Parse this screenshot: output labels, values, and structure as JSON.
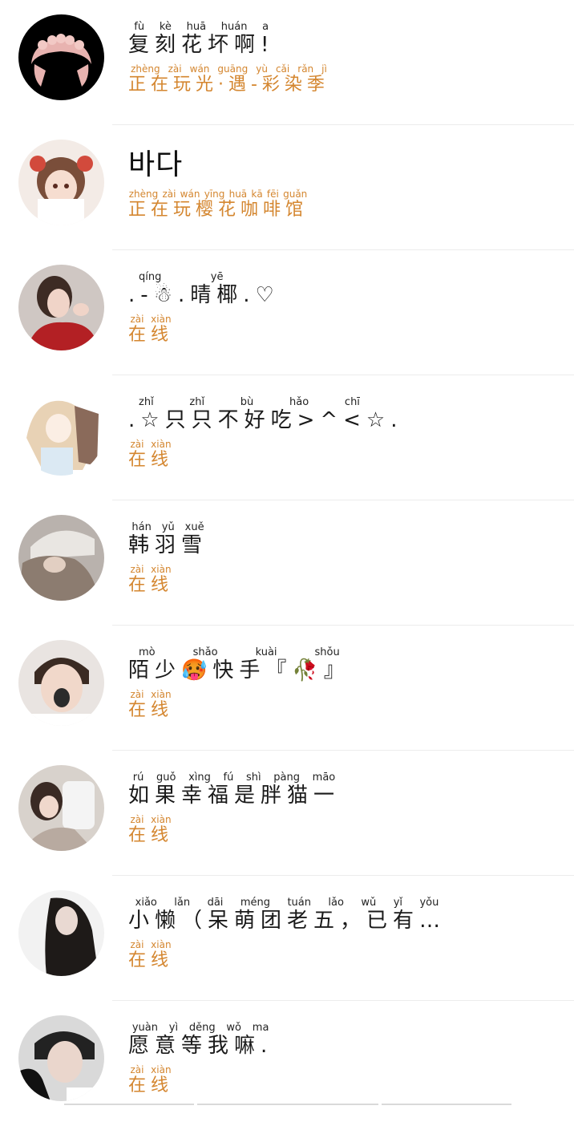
{
  "contacts": [
    {
      "name_text": "复刻花坏啊!",
      "name_pinyin": "fù  kè  huā huán  a",
      "status_text": "正在玩光·遇-彩染季",
      "status_pinyin": "zhèng zài wán guāng  yù   cǎi  rǎn  jì"
    },
    {
      "name_text": "바다",
      "name_pinyin": "",
      "status_text": "正在玩樱花咖啡馆",
      "status_pinyin": "zhèng zài wán yīng huā kā fēi guǎn"
    },
    {
      "name_text": ".-☃.晴椰.♡",
      "name_pinyin": "     qíng  yē",
      "status_text": "在线",
      "status_pinyin": "zài xiàn"
    },
    {
      "name_text": ".☆只只不好吃>^<☆.",
      "name_pinyin": "  zhǐ zhǐ bù hǎo chī",
      "status_text": "在线",
      "status_pinyin": "zài xiàn"
    },
    {
      "name_text": "韩羽雪",
      "name_pinyin": "hán yǔ xuě",
      "status_text": "在线",
      "status_pinyin": "zài xiàn"
    },
    {
      "name_text": "陌少🥵快手『🥀』",
      "name_pinyin": "mò shǎo    kuài shǒu",
      "status_text": "在线",
      "status_pinyin": "zài xiàn"
    },
    {
      "name_text": "如果幸福是胖猫一",
      "name_pinyin": "rú guǒ xìng fú shì pàng māo",
      "status_text": "在线",
      "status_pinyin": "zài xiàn"
    },
    {
      "name_text": "小懒（呆萌团老五，已有…",
      "name_pinyin": "xiǎo lǎn  dāi méng tuán lǎo wǔ  yǐ yǒu",
      "status_text": "在线",
      "status_pinyin": "zài xiàn"
    },
    {
      "name_text": "愿意等我嘛.",
      "name_pinyin": "yuàn yì děng wǒ ma",
      "status_text": "在线",
      "status_pinyin": "zài xiàn"
    }
  ],
  "colors": {
    "status": "#d4862f",
    "name": "#1a1a1a",
    "divider": "#ececec"
  }
}
